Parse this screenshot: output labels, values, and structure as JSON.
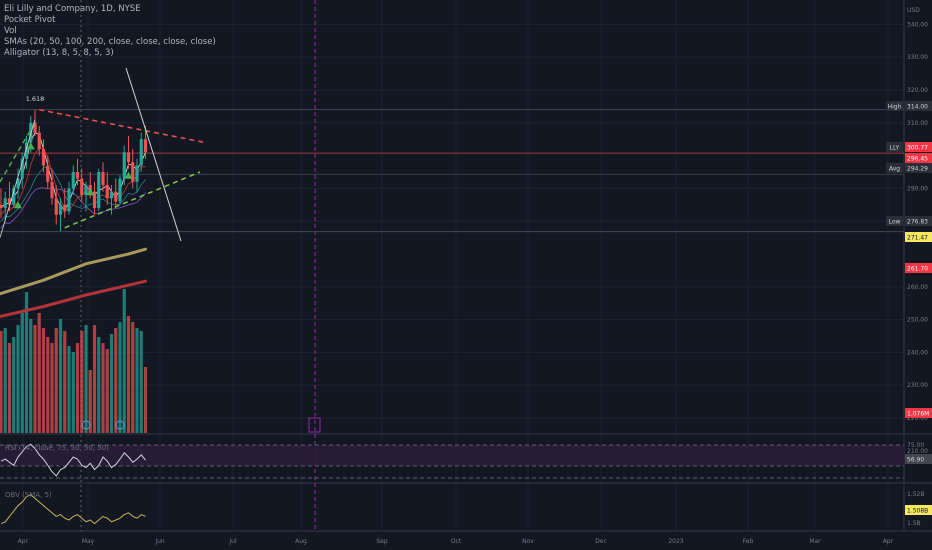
{
  "header": {
    "title": "Eli Lilly and Company, 1D, NYSE",
    "indicators": [
      "Pocket Pivot",
      "Vol",
      "SMAs (20, 50, 100, 200, close, close, close, close)",
      "Alligator (13, 8, 5, 8, 5, 3)"
    ]
  },
  "colors": {
    "background": "#131722",
    "grid": "#1e2230",
    "up": "#26a69a",
    "down": "#ef5350",
    "resistance": "#ef5350",
    "support": "#4caf50",
    "sma100": "#a89a5b",
    "sma200": "#b2333a",
    "rsi_band": "#2b1c3b",
    "obv": "#c9b458",
    "cursor": "#9c27b0"
  },
  "chart_data": {
    "type": "candlestick",
    "symbol": "LLY",
    "currency": "USD",
    "x_ticks": [
      "Apr",
      "May",
      "Jun",
      "Jul",
      "Aug",
      "Sep",
      "Oct",
      "Nov",
      "Dec",
      "2023",
      "Feb",
      "Mar",
      "Apr"
    ],
    "price_axis": {
      "ticks": [
        "340.00",
        "330.00",
        "320.00",
        "310.00",
        "290.00",
        "280.00",
        "260.00",
        "250.00",
        "240.00",
        "230.00",
        "220.00",
        "210.00"
      ],
      "labels": [
        {
          "text": "High",
          "value": "314.00",
          "role": "high"
        },
        {
          "text": "LLY",
          "value": "300.77",
          "role": "last"
        },
        {
          "text": "",
          "value": "296.45",
          "role": "pivot"
        },
        {
          "text": "Avg",
          "value": "294.29",
          "role": "avg"
        },
        {
          "text": "Low",
          "value": "276.83",
          "role": "low"
        },
        {
          "text": "",
          "value": "271.47",
          "role": "sma100"
        },
        {
          "text": "",
          "value": "261.70",
          "role": "sma200"
        },
        {
          "text": "",
          "value": "1.076M",
          "role": "volume"
        }
      ]
    },
    "fib_label": "1.618",
    "candles": [
      [
        285,
        290,
        281,
        284
      ],
      [
        284,
        289,
        280,
        287
      ],
      [
        287,
        292,
        283,
        285
      ],
      [
        285,
        291,
        284,
        290
      ],
      [
        290,
        296,
        287,
        293
      ],
      [
        293,
        301,
        290,
        299
      ],
      [
        299,
        306,
        296,
        304
      ],
      [
        304,
        312,
        301,
        310
      ],
      [
        310,
        314,
        306,
        307
      ],
      [
        307,
        309,
        300,
        302
      ],
      [
        302,
        305,
        295,
        297
      ],
      [
        297,
        300,
        290,
        292
      ],
      [
        292,
        296,
        285,
        287
      ],
      [
        287,
        291,
        279,
        282
      ],
      [
        282,
        287,
        277,
        285
      ],
      [
        285,
        290,
        281,
        283
      ],
      [
        283,
        292,
        282,
        290
      ],
      [
        290,
        297,
        288,
        295
      ],
      [
        295,
        299,
        291,
        293
      ],
      [
        293,
        296,
        286,
        288
      ],
      [
        288,
        292,
        283,
        291
      ],
      [
        291,
        295,
        287,
        289
      ],
      [
        289,
        292,
        282,
        284
      ],
      [
        284,
        296,
        283,
        295
      ],
      [
        295,
        298,
        289,
        291
      ],
      [
        291,
        295,
        285,
        287
      ],
      [
        287,
        291,
        282,
        289
      ],
      [
        289,
        293,
        284,
        286
      ],
      [
        286,
        294,
        285,
        293
      ],
      [
        293,
        303,
        291,
        301
      ],
      [
        301,
        306,
        296,
        298
      ],
      [
        298,
        302,
        290,
        292
      ],
      [
        292,
        299,
        289,
        297
      ],
      [
        297,
        307,
        295,
        305
      ],
      [
        305,
        309,
        299,
        301
      ]
    ],
    "volume": [
      170,
      175,
      150,
      160,
      180,
      200,
      235,
      190,
      180,
      200,
      175,
      160,
      150,
      175,
      190,
      170,
      145,
      135,
      150,
      170,
      180,
      105,
      180,
      160,
      150,
      140,
      165,
      175,
      185,
      240,
      195,
      185,
      175,
      170,
      110
    ],
    "sma100": [
      {
        "i": -15,
        "v": 253
      },
      {
        "i": 0,
        "v": 258
      },
      {
        "i": 10,
        "v": 262
      },
      {
        "i": 20,
        "v": 267
      },
      {
        "i": 30,
        "v": 270
      },
      {
        "i": 34,
        "v": 271.47
      }
    ],
    "sma200": [
      {
        "i": -15,
        "v": 248
      },
      {
        "i": 0,
        "v": 251
      },
      {
        "i": 10,
        "v": 254
      },
      {
        "i": 20,
        "v": 257.5
      },
      {
        "i": 30,
        "v": 260.5
      },
      {
        "i": 34,
        "v": 261.7
      }
    ],
    "rsi": {
      "label": "RSI (14, close, 75, 50, 50, 50)",
      "ticks": [
        "75.00"
      ],
      "last": "56.90",
      "values": [
        56,
        58,
        55,
        52,
        60,
        65,
        70,
        72,
        68,
        62,
        58,
        52,
        46,
        42,
        48,
        50,
        55,
        60,
        58,
        52,
        50,
        54,
        48,
        52,
        60,
        56,
        50,
        53,
        58,
        64,
        60,
        55,
        58,
        62,
        57
      ]
    },
    "obv": {
      "label": "OBV (SMA, 5)",
      "ticks": [
        "1.52B",
        "1.5B"
      ],
      "last": "1.508B",
      "values": [
        1.505,
        1.506,
        1.509,
        1.512,
        1.515,
        1.517,
        1.52,
        1.521,
        1.519,
        1.517,
        1.515,
        1.513,
        1.511,
        1.509,
        1.51,
        1.508,
        1.507,
        1.509,
        1.51,
        1.508,
        1.506,
        1.507,
        1.505,
        1.507,
        1.509,
        1.508,
        1.506,
        1.507,
        1.508,
        1.51,
        1.511,
        1.509,
        1.508,
        1.51,
        1.509
      ]
    }
  }
}
